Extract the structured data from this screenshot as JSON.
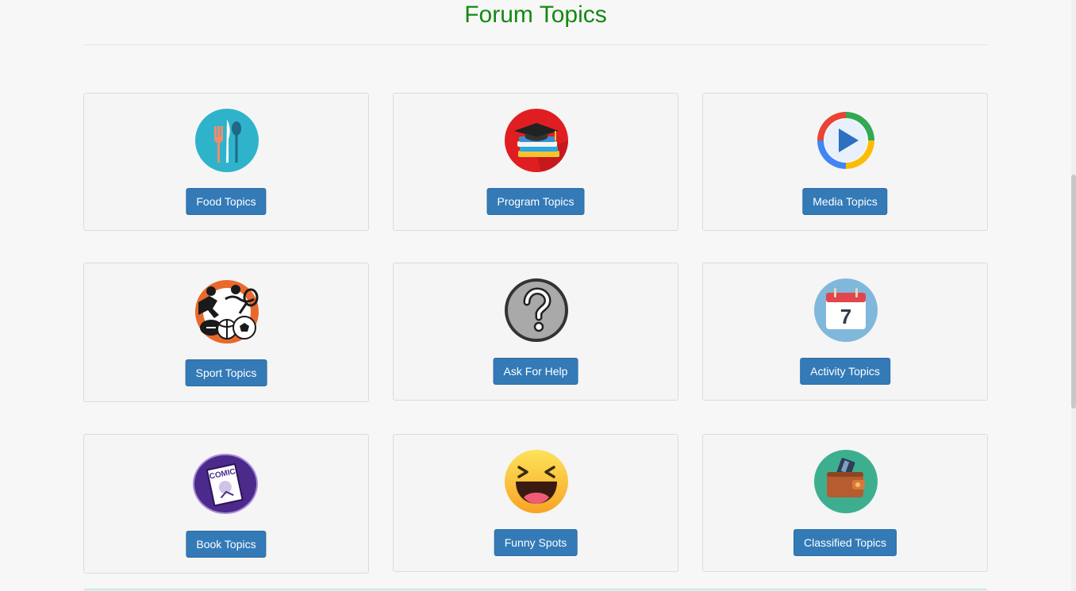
{
  "header": {
    "title": "Forum Topics"
  },
  "colors": {
    "title": "#138a13",
    "button": "#337ab7"
  },
  "cards": [
    {
      "label": "Food Topics",
      "icon": "utensils-icon"
    },
    {
      "label": "Program Topics",
      "icon": "graduation-books-icon"
    },
    {
      "label": "Media Topics",
      "icon": "play-icon"
    },
    {
      "label": "Sport Topics",
      "icon": "sports-icon"
    },
    {
      "label": "Ask For Help",
      "icon": "question-icon"
    },
    {
      "label": "Activity Topics",
      "icon": "calendar-icon"
    },
    {
      "label": "Book Topics",
      "icon": "comic-book-icon"
    },
    {
      "label": "Funny Spots",
      "icon": "laughing-face-icon"
    },
    {
      "label": "Classified Topics",
      "icon": "wallet-icon"
    }
  ],
  "calendar_day": "7",
  "comic_word": "COMIC"
}
